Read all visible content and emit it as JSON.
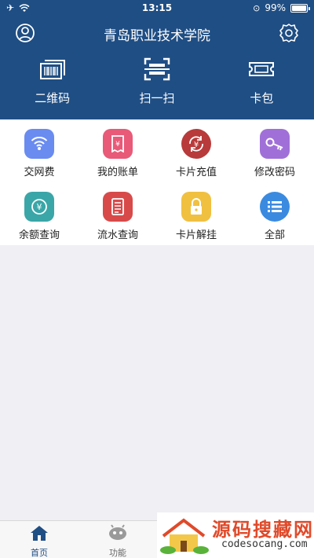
{
  "status_bar": {
    "time": "13:15",
    "battery": "99%",
    "battery_level": 0.99
  },
  "header": {
    "title": "青岛职业技术学院",
    "user_icon": "user-icon",
    "settings_icon": "gear-icon"
  },
  "quick_actions": [
    {
      "label": "二维码",
      "icon": "qr-code-icon"
    },
    {
      "label": "扫一扫",
      "icon": "scan-icon"
    },
    {
      "label": "卡包",
      "icon": "card-wallet-icon"
    }
  ],
  "grid": [
    {
      "label": "交网费",
      "icon": "wifi-icon",
      "color": "#6a8cf0"
    },
    {
      "label": "我的账单",
      "icon": "bill-icon",
      "color": "#e85a78"
    },
    {
      "label": "卡片充值",
      "icon": "recharge-icon",
      "color": "#b83a3a"
    },
    {
      "label": "修改密码",
      "icon": "key-icon",
      "color": "#a070d8"
    },
    {
      "label": "余额查询",
      "icon": "balance-icon",
      "color": "#3aa6a8"
    },
    {
      "label": "流水查询",
      "icon": "transactions-icon",
      "color": "#d84a4a"
    },
    {
      "label": "卡片解挂",
      "icon": "lock-icon",
      "color": "#f0c040"
    },
    {
      "label": "全部",
      "icon": "all-icon",
      "color": "#3a8ae0"
    }
  ],
  "tabbar": [
    {
      "label": "首页",
      "icon": "home-icon",
      "active": true
    },
    {
      "label": "功能",
      "icon": "robot-icon",
      "active": false
    }
  ],
  "watermark": {
    "title": "源码搜藏网",
    "url": "codesocang.com"
  },
  "colors": {
    "brand": "#1f4e84",
    "background": "#efeff4"
  }
}
